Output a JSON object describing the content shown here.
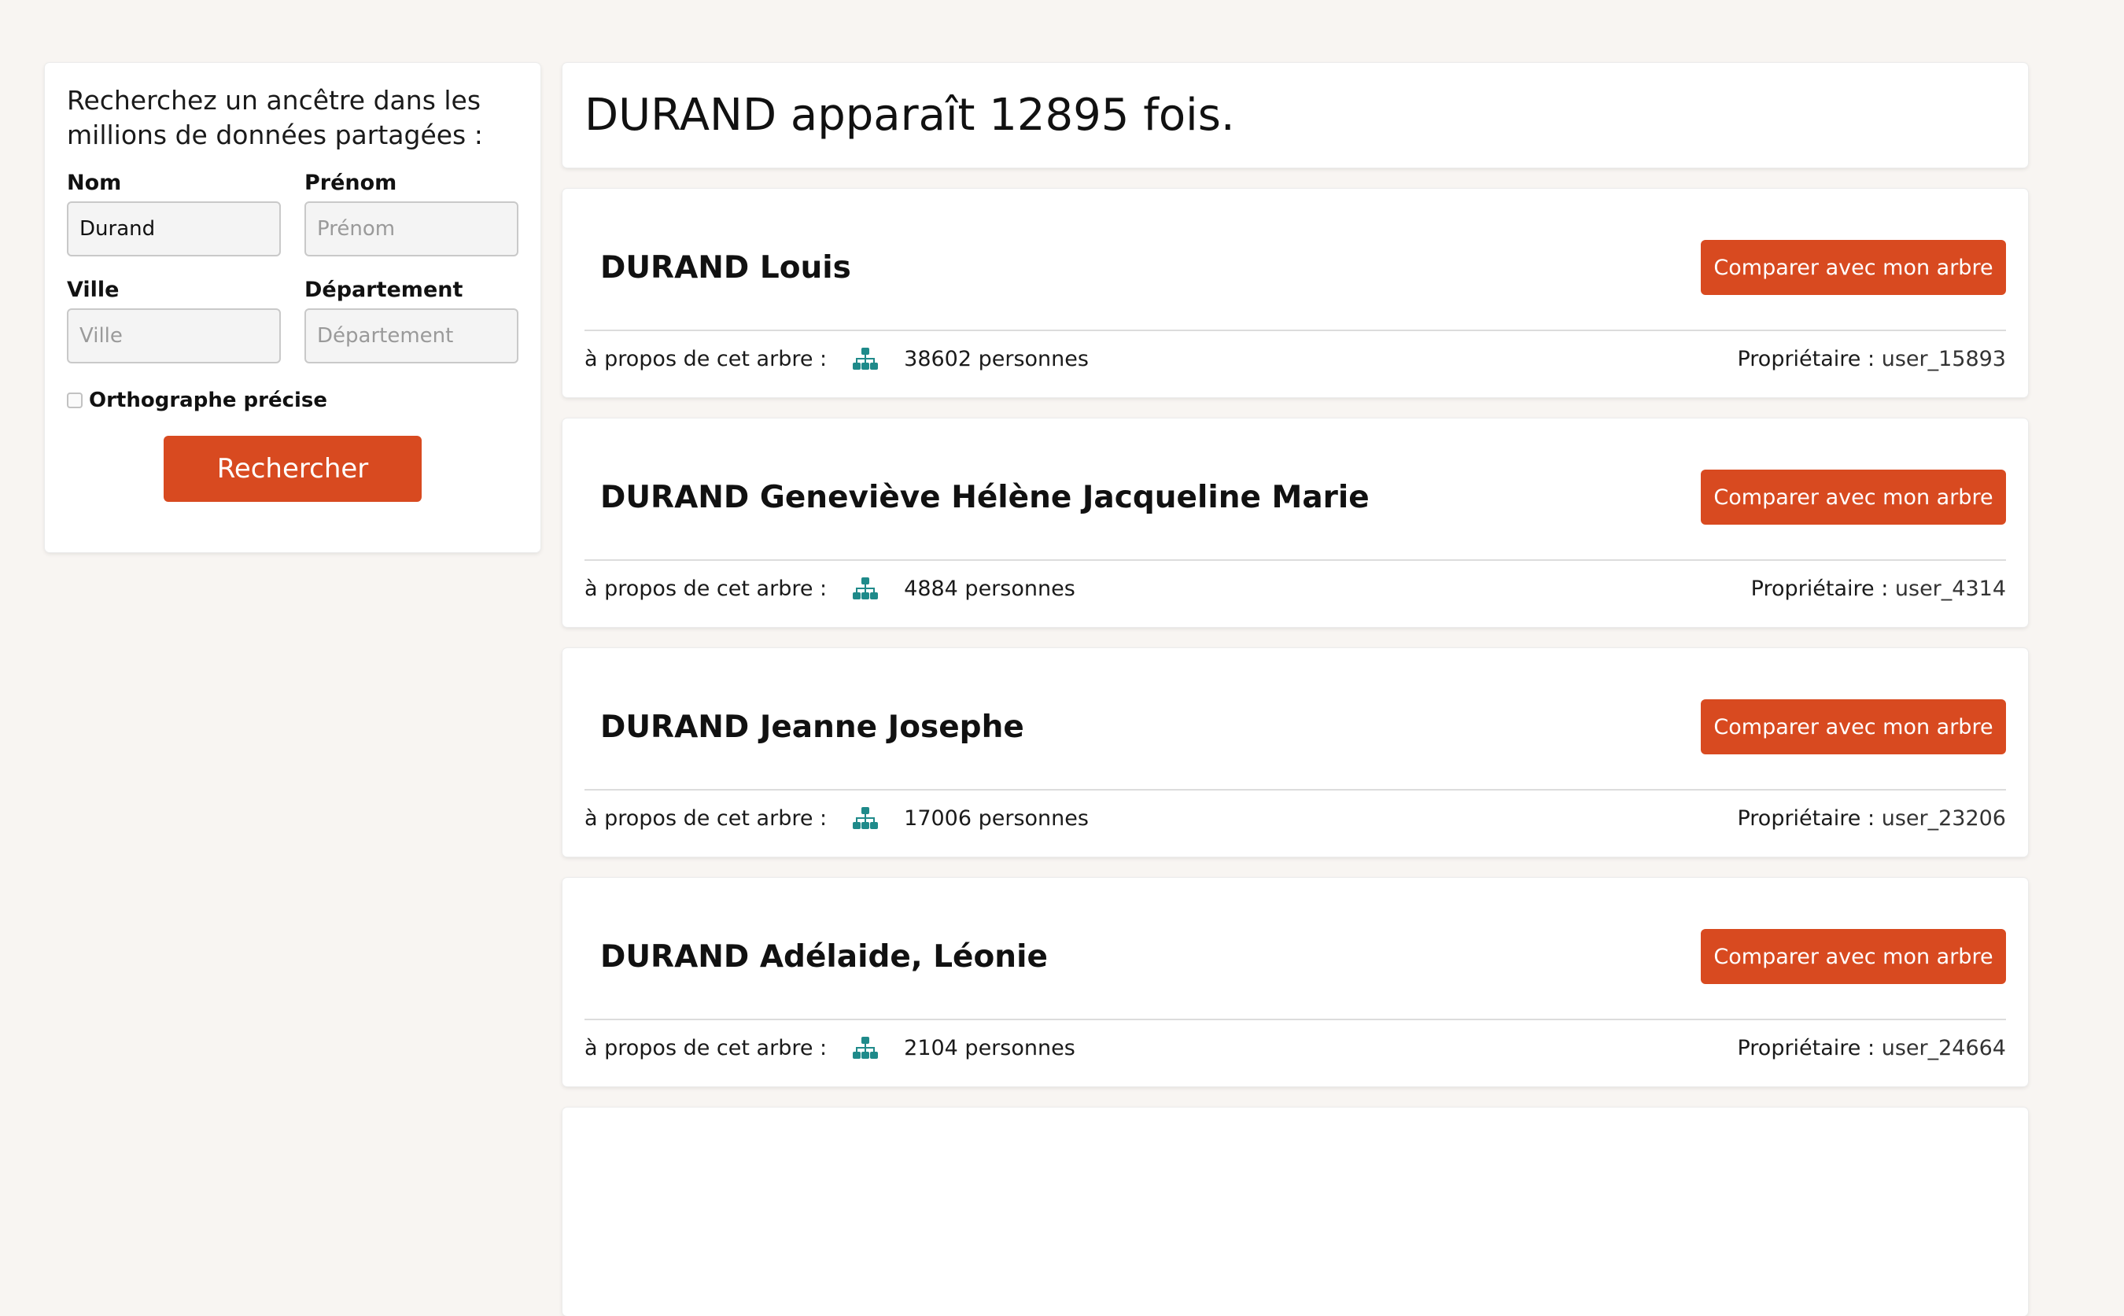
{
  "search": {
    "intro": "Recherchez un ancêtre dans les millions de données partagées :",
    "fields": {
      "nom": {
        "label": "Nom",
        "value": "Durand",
        "placeholder": "Nom"
      },
      "prenom": {
        "label": "Prénom",
        "value": "",
        "placeholder": "Prénom"
      },
      "ville": {
        "label": "Ville",
        "value": "",
        "placeholder": "Ville"
      },
      "departement": {
        "label": "Département",
        "value": "",
        "placeholder": "Département"
      }
    },
    "exact_spelling": {
      "label": "Orthographe précise",
      "checked": false
    },
    "button_label": "Rechercher"
  },
  "results": {
    "title": "DURAND apparaît 12895 fois.",
    "items": [
      {
        "name": "DURAND Louis",
        "compare_label": "Comparer avec mon arbre",
        "about_label": "à propos de cet arbre :",
        "persons": "38602 personnes",
        "owner_label": "Propriétaire :",
        "owner_user": "user_15893"
      },
      {
        "name": "DURAND Geneviève Hélène Jacqueline Marie",
        "compare_label": "Comparer avec mon arbre",
        "about_label": "à propos de cet arbre :",
        "persons": "4884 personnes",
        "owner_label": "Propriétaire :",
        "owner_user": "user_4314"
      },
      {
        "name": "DURAND Jeanne Josephe",
        "compare_label": "Comparer avec mon arbre",
        "about_label": "à propos de cet arbre :",
        "persons": "17006 personnes",
        "owner_label": "Propriétaire :",
        "owner_user": "user_23206"
      },
      {
        "name": "DURAND Adélaide, Léonie",
        "compare_label": "Comparer avec mon arbre",
        "about_label": "à propos de cet arbre :",
        "persons": "2104 personnes",
        "owner_label": "Propriétaire :",
        "owner_user": "user_24664"
      }
    ]
  },
  "icons": {
    "tree": "family-tree-icon"
  },
  "colors": {
    "accent": "#d84a20",
    "tree_icon": "#1f8a8a",
    "background": "#f8f5f2"
  }
}
